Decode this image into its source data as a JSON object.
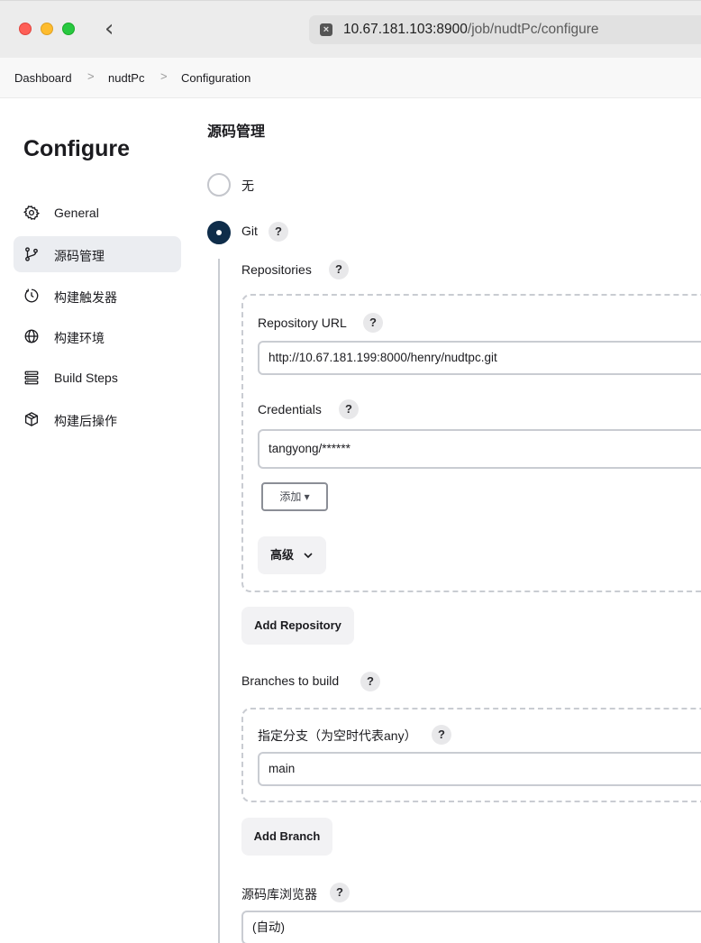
{
  "browser": {
    "url_host": "10.67.181.103:8900",
    "url_path": "/job/nudtPc/configure"
  },
  "breadcrumb": {
    "items": [
      "Dashboard",
      "nudtPc",
      "Configuration"
    ]
  },
  "sidebar": {
    "title": "Configure",
    "items": [
      {
        "label": "General",
        "icon": "gear-icon"
      },
      {
        "label": "源码管理",
        "icon": "branch-icon"
      },
      {
        "label": "构建触发器",
        "icon": "clock-icon"
      },
      {
        "label": "构建环境",
        "icon": "globe-icon"
      },
      {
        "label": "Build Steps",
        "icon": "list-icon"
      },
      {
        "label": "构建后操作",
        "icon": "cube-icon"
      }
    ]
  },
  "scm": {
    "section_title": "源码管理",
    "option_none": "无",
    "option_git": "Git",
    "repositories_label": "Repositories",
    "repo_url_label": "Repository URL",
    "repo_url_value": "http://10.67.181.199:8000/henry/nudtpc.git",
    "credentials_label": "Credentials",
    "credentials_value": "tangyong/******",
    "add_button": "添加 ▾",
    "advanced_button": "高级",
    "add_repository_button": "Add Repository",
    "branches_label": "Branches to build",
    "branch_spec_label": "指定分支（为空时代表any）",
    "branch_spec_value": "main",
    "add_branch_button": "Add Branch",
    "browser_label": "源码库浏览器",
    "browser_value": "(自动)",
    "help": "?"
  }
}
